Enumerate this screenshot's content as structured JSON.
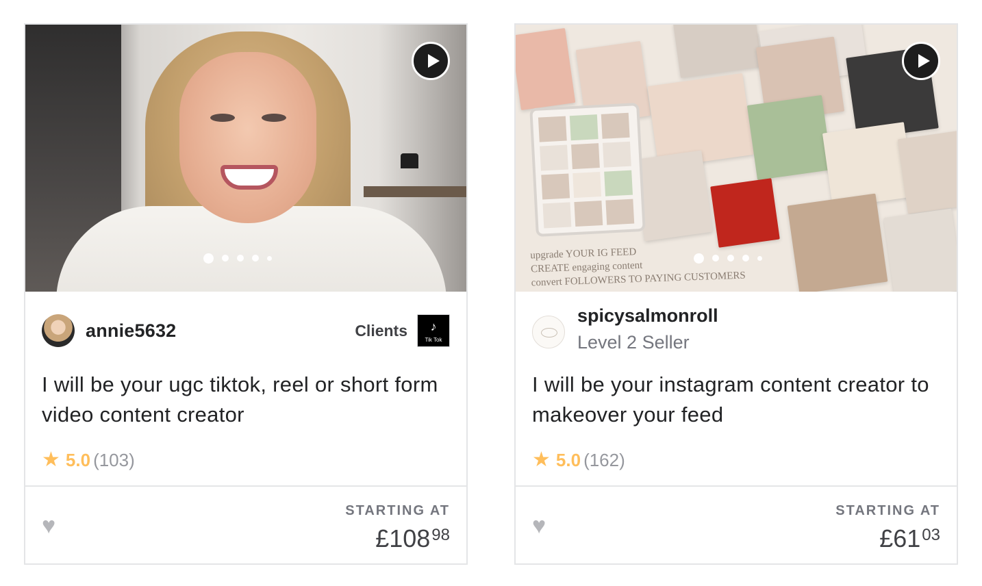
{
  "cards": [
    {
      "seller": {
        "username": "annie5632"
      },
      "clients": {
        "label": "Clients",
        "logo_text": "Tik Tok",
        "logo_glyph": "♪"
      },
      "title": "I will be your ugc tiktok, reel or short form video content creator",
      "rating": {
        "score": "5.0",
        "count": "(103)"
      },
      "starting_label": "STARTING AT",
      "price": {
        "main": "£108",
        "cents": "98"
      },
      "slides": {
        "count": 5,
        "active": 1
      }
    },
    {
      "seller": {
        "username": "spicysalmonroll",
        "level": "Level 2 Seller"
      },
      "title": "I will be your instagram content creator to makeover your feed",
      "rating": {
        "score": "5.0",
        "count": "(162)"
      },
      "starting_label": "STARTING AT",
      "price": {
        "main": "£61",
        "cents": "03"
      },
      "slides": {
        "count": 5,
        "active": 1
      },
      "image_caption": [
        "upgrade YOUR IG FEED",
        "CREATE engaging content",
        "convert FOLLOWERS TO PAYING CUSTOMERS"
      ]
    }
  ],
  "icons": {
    "play": "play-icon",
    "star": "star-icon",
    "heart": "heart-icon"
  },
  "colors": {
    "star": "#ffbe5b",
    "muted": "#74767e",
    "text": "#222325",
    "border": "#e4e5e7"
  }
}
